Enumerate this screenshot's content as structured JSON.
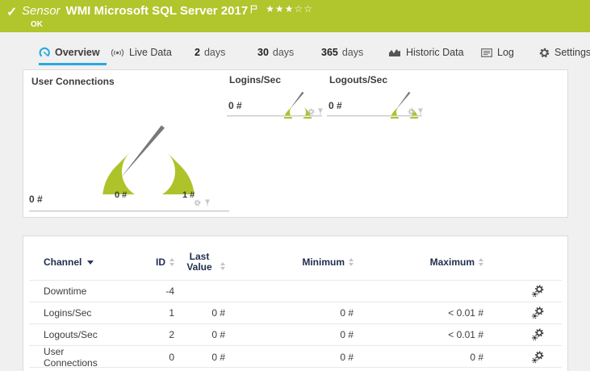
{
  "colors": {
    "brand_green": "#b1c52c",
    "accent_blue": "#2aa9e0",
    "header_navy": "#1f2d4e",
    "needle_gray": "#787878"
  },
  "header": {
    "check": "✓",
    "kind": "Sensor",
    "title": "WMI Microsoft SQL Server 2017",
    "status": "OK",
    "rating": "★★★☆☆"
  },
  "tabs": [
    {
      "label": "Overview",
      "icon": "gauge-icon",
      "active": true
    },
    {
      "label": "Live Data",
      "icon": "broadcast-icon"
    },
    {
      "number": "2",
      "label": "days"
    },
    {
      "number": "30",
      "label": "days"
    },
    {
      "number": "365",
      "label": "days"
    },
    {
      "label": "Historic Data",
      "icon": "area-chart-icon"
    },
    {
      "label": "Log",
      "icon": "log-icon"
    },
    {
      "label": "Settings",
      "icon": "gear-icon"
    }
  ],
  "gauges": {
    "primary": {
      "title": "User Connections",
      "value": "0 #",
      "scale_min": "0 #",
      "scale_max": "1 #"
    },
    "logins": {
      "title": "Logins/Sec",
      "value": "0 #"
    },
    "logouts": {
      "title": "Logouts/Sec",
      "value": "0 #"
    }
  },
  "channels": {
    "headers": {
      "channel": "Channel",
      "id": "ID",
      "last": "Last Value",
      "min": "Minimum",
      "max": "Maximum"
    },
    "rows": [
      {
        "channel": "Downtime",
        "id": "-4",
        "last": "",
        "min": "",
        "max": ""
      },
      {
        "channel": "Logins/Sec",
        "id": "1",
        "last": "0 #",
        "min": "0 #",
        "max": "< 0.01 #"
      },
      {
        "channel": "Logouts/Sec",
        "id": "2",
        "last": "0 #",
        "min": "0 #",
        "max": "< 0.01 #"
      },
      {
        "channel": "User Connections",
        "id": "0",
        "last": "0 #",
        "min": "0 #",
        "max": "0 #"
      }
    ]
  },
  "icons": {
    "gear": "settings cog shape",
    "pin": "pushpin shape",
    "channel-settings": "double gear shape"
  }
}
